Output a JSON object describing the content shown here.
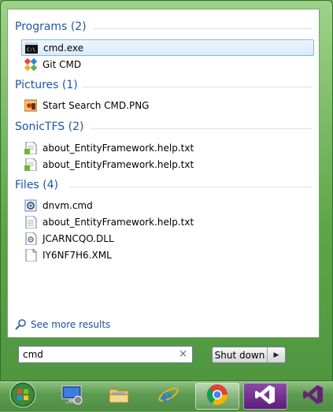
{
  "groups": [
    {
      "title": "Programs (2)",
      "items": [
        {
          "label": "cmd.exe",
          "icon": "cmd-icon",
          "selected": true
        },
        {
          "label": "Git CMD",
          "icon": "git-icon",
          "selected": false
        }
      ]
    },
    {
      "title": "Pictures (1)",
      "items": [
        {
          "label": "Start Search CMD.PNG",
          "icon": "image-file-icon",
          "selected": false
        }
      ]
    },
    {
      "title": "SonicTFS (2)",
      "items": [
        {
          "label": "about_EntityFramework.help.txt",
          "icon": "text-file-icon",
          "selected": false
        },
        {
          "label": "about_EntityFramework.help.txt",
          "icon": "text-file-icon",
          "selected": false
        }
      ]
    },
    {
      "title": "Files (4)",
      "items": [
        {
          "label": "dnvm.cmd",
          "icon": "script-file-icon",
          "selected": false
        },
        {
          "label": "about_EntityFramework.help.txt",
          "icon": "text-file-icon",
          "selected": false
        },
        {
          "label": "JCARNCQO.DLL",
          "icon": "dll-file-icon",
          "selected": false
        },
        {
          "label": "IY6NF7H6.XML",
          "icon": "blank-file-icon",
          "selected": false
        }
      ]
    }
  ],
  "see_more": "See more results",
  "search": {
    "value": "cmd",
    "clear": "×"
  },
  "shutdown": {
    "label": "Shut down",
    "arrow": "▶"
  },
  "taskbar": {
    "items": [
      {
        "name": "start-orb",
        "icon": "windows-logo-icon"
      },
      {
        "name": "remote-desktop",
        "icon": "remote-desktop-icon"
      },
      {
        "name": "file-explorer",
        "icon": "folder-icon"
      },
      {
        "name": "internet-explorer",
        "icon": "ie-icon"
      },
      {
        "name": "chrome",
        "icon": "chrome-icon"
      },
      {
        "name": "visual-studio-1",
        "icon": "visual-studio-icon"
      },
      {
        "name": "visual-studio-2",
        "icon": "visual-studio-icon"
      }
    ]
  },
  "colors": {
    "group_title": "#1c55a8",
    "selection_border": "#88b6e0",
    "frame_green": "#5da548",
    "vs_purple": "#68217a"
  }
}
